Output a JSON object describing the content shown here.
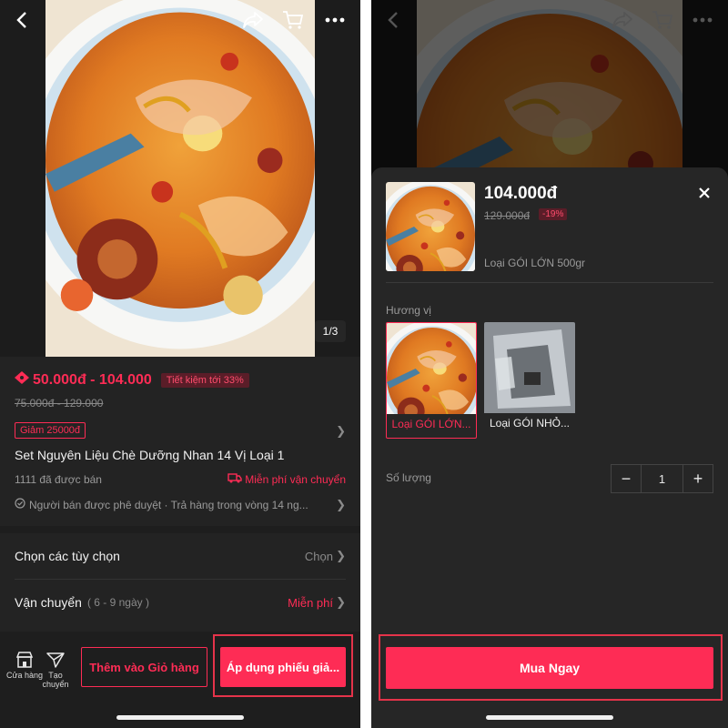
{
  "left": {
    "image_counter": "1/3",
    "price_range": "50.000đ - 104.000",
    "save_badge": "Tiết kiệm tới 33%",
    "old_price_range": "75.000đ - 129.000",
    "coupon": "Giảm 25000đ",
    "product_title": "Set Nguyên Liệu Chè Dưỡng Nhan 14 Vị Loại 1",
    "sold_count": "1111 đã được bán",
    "free_shipping": "Miễn phí vận chuyển",
    "assurance": "Người bán được phê duyệt · Trả hàng trong vòng 14 ng...",
    "options_row": {
      "label": "Chọn các tùy chọn",
      "value": "Chọn"
    },
    "shipping_row": {
      "label": "Vận chuyển",
      "days": "( 6 - 9 ngày )",
      "value": "Miễn phí"
    },
    "bottom": {
      "store_label": "Cửa hàng",
      "share_label": "Tạo chuyển",
      "add_to_cart": "Thêm vào Giỏ hàng",
      "apply_coupon": "Áp dụng phiếu giả..."
    }
  },
  "right": {
    "price": "104.000đ",
    "old_price": "129.000đ",
    "discount": "-19%",
    "variant_selected": "Loại GÓI LỚN 500gr",
    "flavor_label": "Hương vị",
    "options": [
      {
        "label": "Loại GÓI LỚN...",
        "selected": true
      },
      {
        "label": "Loại GÓI NHỎ...",
        "selected": false
      }
    ],
    "quantity_label": "Số lượng",
    "quantity": "1",
    "buy_now": "Mua Ngay"
  },
  "colors": {
    "accent": "#fe2c55",
    "background": "#1e1e1e",
    "highlight_box": "#e5334a"
  },
  "icons": [
    "back-icon",
    "share-icon",
    "cart-icon",
    "more-icon",
    "ticket-icon",
    "truck-icon",
    "check-circle-icon",
    "chevron-right-icon",
    "store-icon",
    "send-icon",
    "close-icon",
    "minus-icon",
    "plus-icon"
  ]
}
